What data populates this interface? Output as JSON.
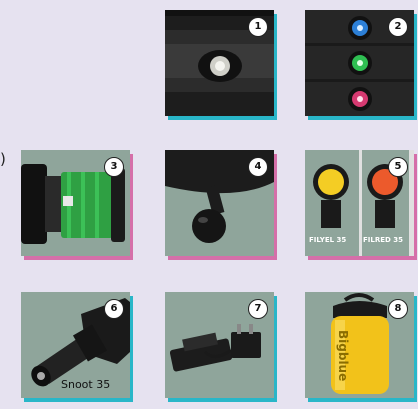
{
  "accessories": [
    {
      "number": "1",
      "icon": "led-light-head"
    },
    {
      "number": "2",
      "icon": "color-led-variants"
    },
    {
      "number": "3",
      "icon": "battery-pack"
    },
    {
      "number": "4",
      "icon": "ball-mount"
    },
    {
      "number": "5",
      "icon": "color-filters",
      "labels": [
        "FILYEL 35",
        "FILRED 35"
      ]
    },
    {
      "number": "6",
      "icon": "snoot",
      "label": "Snoot  35"
    },
    {
      "number": "7",
      "icon": "battery-charger"
    },
    {
      "number": "8",
      "icon": "dry-bag",
      "label": "Bigblue"
    }
  ],
  "left_edge_fragment": ")",
  "colors": {
    "background": "#e6e2f0",
    "tile_shadow_cyan": "#29b6c8",
    "tile_shadow_pink": "#d56fa9",
    "tile_fill": "#8fa59b"
  }
}
